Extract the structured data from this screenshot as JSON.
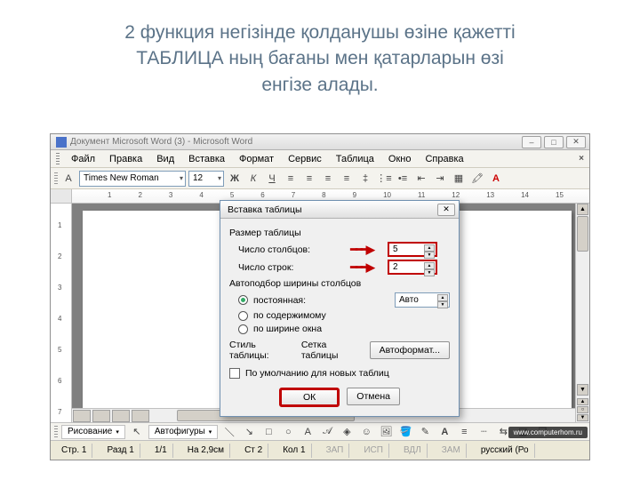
{
  "slide": {
    "line1": "2 функция негізінде қолданушы өзіне қажетті",
    "line2": "ТАБЛИЦА ның бағаны мен қатарларын өзі",
    "line3": "енгізе алады."
  },
  "window": {
    "title": "Документ Microsoft Word (3) - Microsoft Word"
  },
  "menu": [
    "Файл",
    "Правка",
    "Вид",
    "Вставка",
    "Формат",
    "Сервис",
    "Таблица",
    "Окно",
    "Справка"
  ],
  "toolbar": {
    "font": "Times New Roman",
    "size": "12"
  },
  "ruler_h": [
    "1",
    "2",
    "3",
    "4",
    "5",
    "6",
    "7",
    "8",
    "9",
    "10",
    "11",
    "12",
    "13",
    "14",
    "15"
  ],
  "ruler_v": [
    "1",
    "2",
    "3",
    "4",
    "5",
    "6",
    "7"
  ],
  "drawbar": {
    "draw": "Рисование",
    "autoshapes": "Автофигуры"
  },
  "status": {
    "page": "Стр. 1",
    "section": "Разд 1",
    "pages": "1/1",
    "at": "На 2,9см",
    "line": "Ст 2",
    "col": "Кол 1",
    "rec": "ЗАП",
    "trk": "ИСП",
    "ext": "ВДЛ",
    "ovr": "ЗАМ",
    "lang": "русский (Ро"
  },
  "watermark": "www.computerhom.ru",
  "dialog": {
    "title": "Вставка таблицы",
    "group_size": "Размер таблицы",
    "cols_label": "Число столбцов:",
    "cols_value": "5",
    "rows_label": "Число строк:",
    "rows_value": "2",
    "group_autofit": "Автоподбор ширины столбцов",
    "opt_fixed": "постоянная:",
    "fixed_value": "Авто",
    "opt_content": "по содержимому",
    "opt_window": "по ширине окна",
    "style_label": "Стиль таблицы:",
    "style_value": "Сетка таблицы",
    "autoformat": "Автоформат...",
    "default_chk": "По умолчанию для новых таблиц",
    "ok": "ОК",
    "cancel": "Отмена"
  }
}
